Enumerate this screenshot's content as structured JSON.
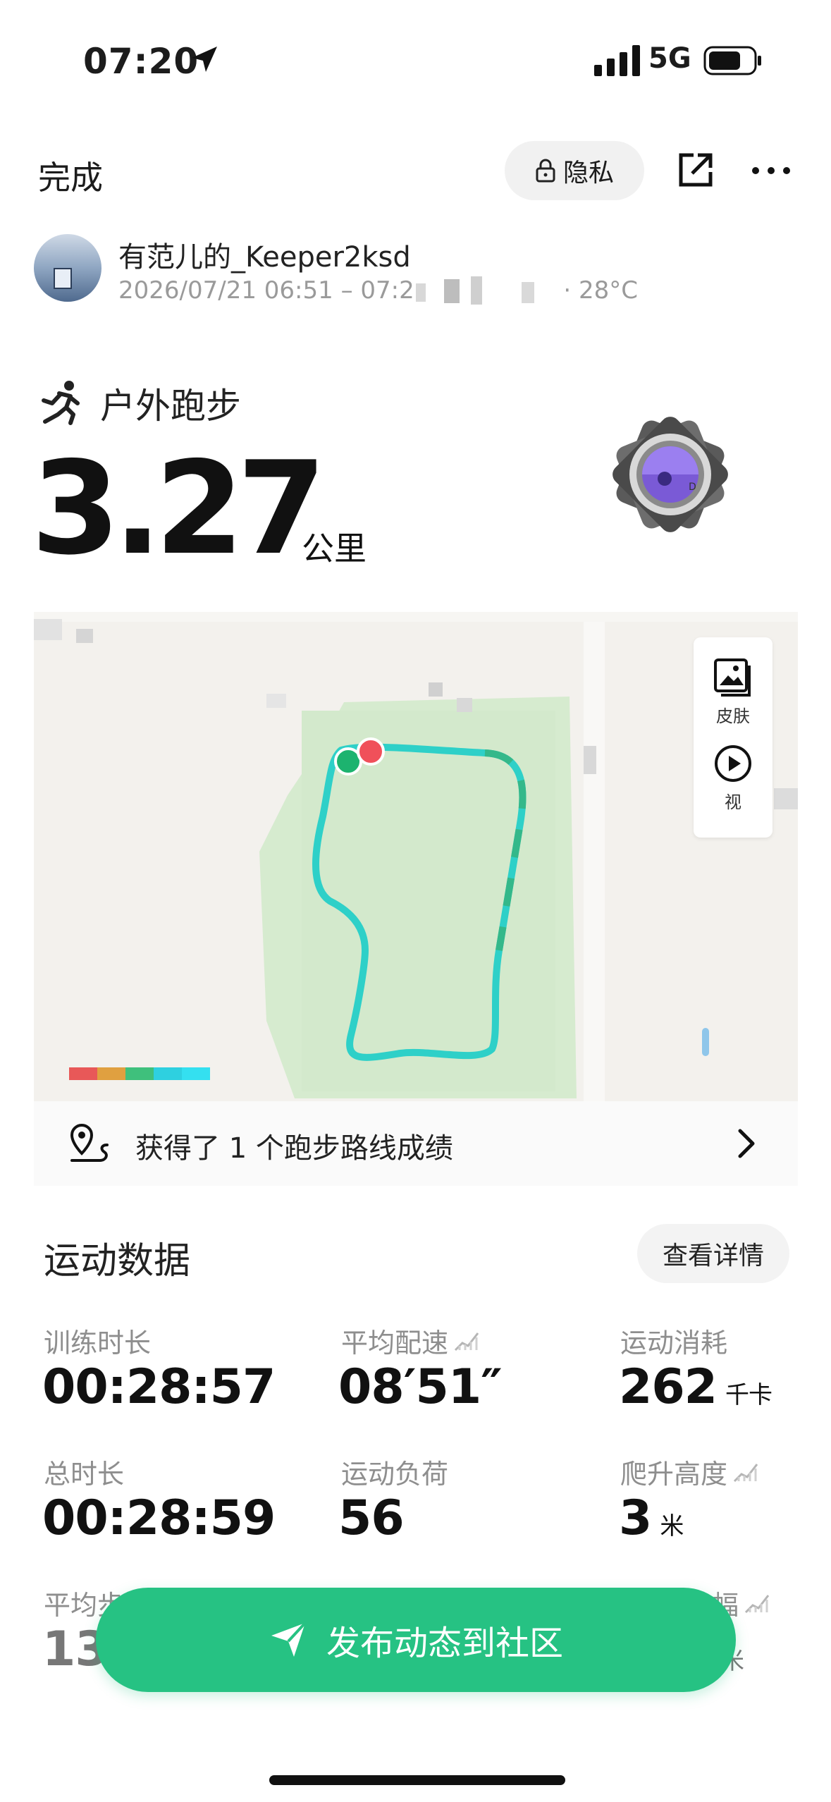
{
  "status_bar": {
    "time": "07:20",
    "network": "5G"
  },
  "header": {
    "done_label": "完成",
    "privacy_label": "隐私"
  },
  "user": {
    "name": "有范儿的_Keeper2ksd",
    "meta": "2026/07/21 06:51 – 07:2",
    "temperature": "· 28°C"
  },
  "activity": {
    "type": "户外跑步",
    "distance": "3.27",
    "distance_unit": "公里"
  },
  "map": {
    "tools": [
      {
        "label": "皮肤",
        "icon": "image-icon"
      },
      {
        "label": "视",
        "icon": "play-icon"
      }
    ],
    "achievement": "获得了 1 个跑步路线成绩"
  },
  "stats_section": {
    "title": "运动数据",
    "detail_label": "查看详情",
    "items": [
      {
        "label": "训练时长",
        "value": "00:28:57",
        "unit": ""
      },
      {
        "label": "平均配速",
        "value": "08′51″",
        "unit": ""
      },
      {
        "label": "运动消耗",
        "value": "262",
        "unit": "千卡"
      },
      {
        "label": "总时长",
        "value": "00:28:59",
        "unit": ""
      },
      {
        "label": "运动负荷",
        "value": "56",
        "unit": ""
      },
      {
        "label": "爬升高度",
        "value": "3",
        "unit": "米"
      },
      {
        "label": "平均步",
        "value": "13",
        "unit": ""
      },
      {
        "label": "幅",
        "value": "",
        "unit": "米"
      }
    ]
  },
  "publish_label": "发布动态到社区",
  "colors": {
    "accent": "#26c283",
    "route": "#2ed0c8",
    "start": "#1db36f",
    "end": "#f0505a"
  }
}
